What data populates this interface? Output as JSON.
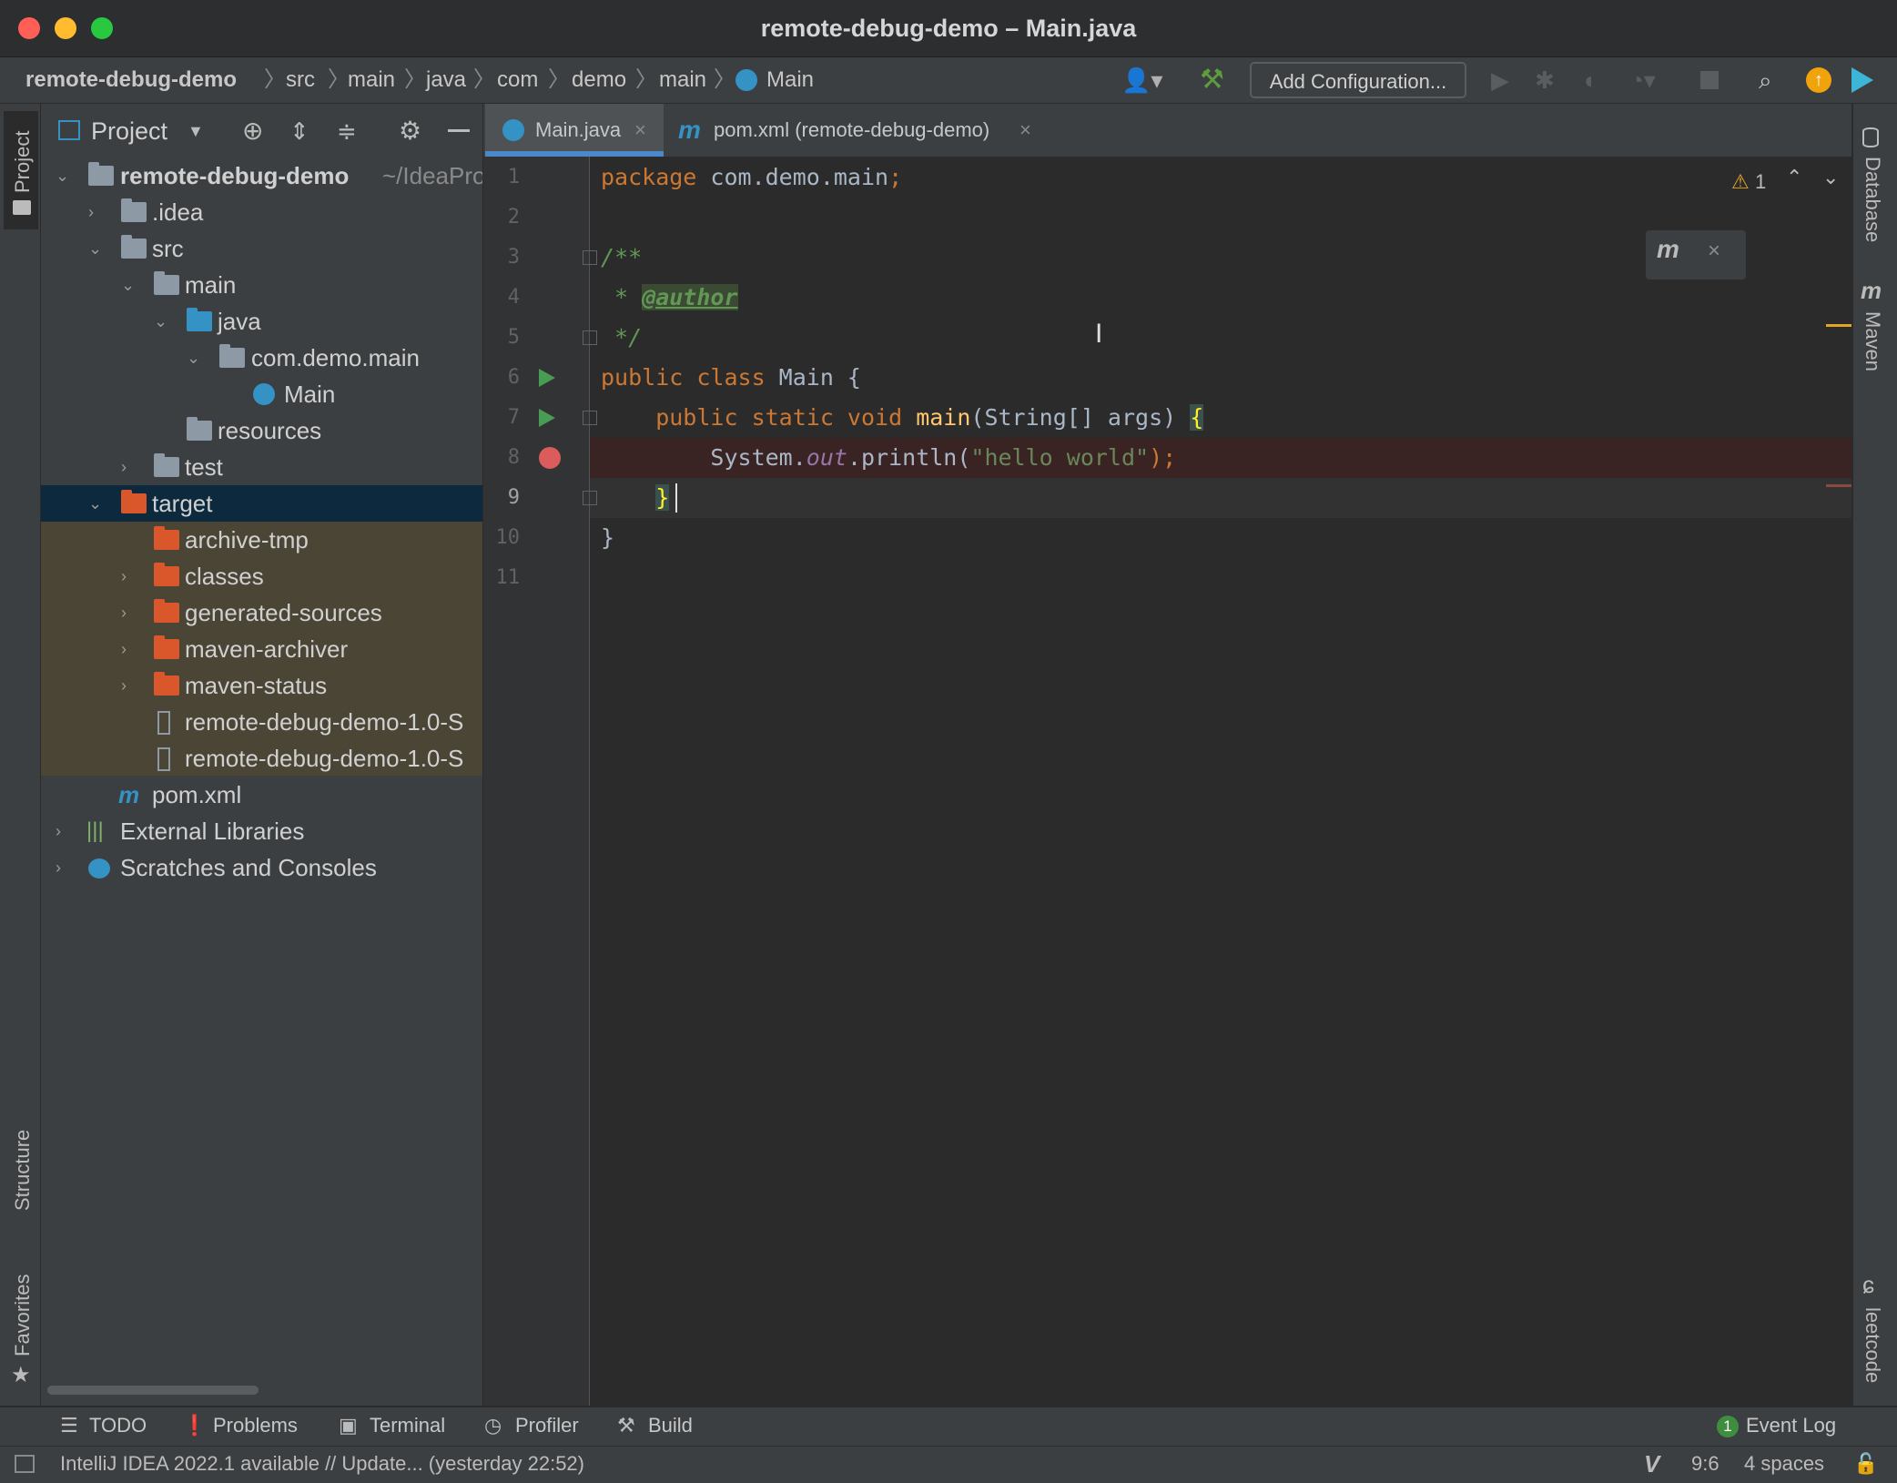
{
  "window": {
    "title": "remote-debug-demo – Main.java"
  },
  "breadcrumbs": [
    "remote-debug-demo",
    "src",
    "main",
    "java",
    "com",
    "demo",
    "main",
    "Main"
  ],
  "toolbar": {
    "add_configuration": "Add Configuration..."
  },
  "project_panel": {
    "title": "Project",
    "tree": [
      {
        "label": "remote-debug-demo",
        "suffix": "~/IdeaPro",
        "arrow": "down"
      },
      {
        "label": ".idea",
        "arrow": "right"
      },
      {
        "label": "src",
        "arrow": "down"
      },
      {
        "label": "main",
        "arrow": "down"
      },
      {
        "label": "java",
        "arrow": "down"
      },
      {
        "label": "com.demo.main",
        "arrow": "down"
      },
      {
        "label": "Main",
        "arrow": "none"
      },
      {
        "label": "resources",
        "arrow": "none"
      },
      {
        "label": "test",
        "arrow": "right"
      },
      {
        "label": "target",
        "arrow": "down"
      },
      {
        "label": "archive-tmp",
        "arrow": "none"
      },
      {
        "label": "classes",
        "arrow": "right"
      },
      {
        "label": "generated-sources",
        "arrow": "right"
      },
      {
        "label": "maven-archiver",
        "arrow": "right"
      },
      {
        "label": "maven-status",
        "arrow": "right"
      },
      {
        "label": "remote-debug-demo-1.0-S",
        "arrow": "none"
      },
      {
        "label": "remote-debug-demo-1.0-S",
        "arrow": "none"
      },
      {
        "label": "pom.xml",
        "arrow": "none"
      },
      {
        "label": "External Libraries",
        "arrow": "right"
      },
      {
        "label": "Scratches and Consoles",
        "arrow": "right"
      }
    ]
  },
  "tabs": [
    {
      "label": "Main.java",
      "active": true
    },
    {
      "label": "pom.xml (remote-debug-demo)",
      "active": false
    }
  ],
  "editor": {
    "line_numbers": [
      "1",
      "2",
      "3",
      "4",
      "5",
      "6",
      "7",
      "8",
      "9",
      "10",
      "11"
    ],
    "warning_count": "1",
    "code": {
      "l1_kw": "package",
      "l1_rest": " com.demo.main",
      "l1_semi": ";",
      "l3": "/**",
      "l4_star": " * ",
      "l4_tag": "@author",
      "l5": " */",
      "l6_kw": "public class",
      "l6_rest": " Main {",
      "l7_kw": "    public static void",
      "l7_fn": " main",
      "l7_rest": "(String[] args) ",
      "l7_brace": "{",
      "l8_a": "        System.",
      "l8_out": "out",
      "l8_b": ".println(",
      "l8_str": "\"hello world\"",
      "l8_c": ");",
      "l9": "    ",
      "l9_brace": "}",
      "l10": "}"
    }
  },
  "left_stripe": {
    "project": "Project",
    "structure": "Structure",
    "favorites": "Favorites"
  },
  "right_stripe": {
    "database": "Database",
    "maven": "Maven",
    "leetcode": "leetcode"
  },
  "bottom_tools": {
    "todo": "TODO",
    "problems": "Problems",
    "terminal": "Terminal",
    "profiler": "Profiler",
    "build": "Build",
    "event_log": "Event Log",
    "event_count": "1"
  },
  "status": {
    "message": "IntelliJ IDEA 2022.1 available // Update... (yesterday 22:52)",
    "position": "9:6",
    "indent": "4 spaces"
  }
}
